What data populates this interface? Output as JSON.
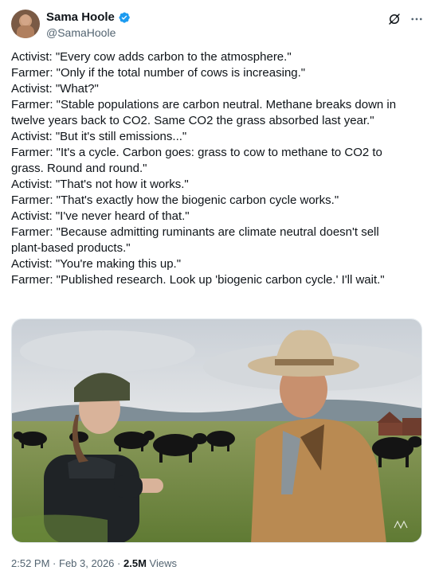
{
  "author": {
    "display_name": "Sama Hoole",
    "handle": "@SamaHoole",
    "verified": true,
    "avatar_icon": "user-avatar"
  },
  "header_actions": {
    "grok_icon": "grok-icon",
    "more_icon": "more-horizontal-icon"
  },
  "tweet": {
    "lines": [
      "Activist: \"Every cow adds carbon to the atmosphere.\"",
      "Farmer: \"Only if the total number of cows is increasing.\"",
      "Activist: \"What?\"",
      "Farmer: \"Stable populations are carbon neutral. Methane breaks down in",
      "twelve years back to CO2. Same CO2 the grass absorbed last year.\"",
      "Activist: \"But it's still emissions...\"",
      "Farmer: \"It's a cycle. Carbon goes: grass to cow to methane to CO2 to",
      "grass. Round and round.\"",
      "Activist: \"That's not how it works.\"",
      "Farmer: \"That's exactly how the biogenic carbon cycle works.\"",
      "Activist: \"I've never heard of that.\"",
      "Farmer: \"Because admitting ruminants are climate neutral doesn't sell",
      "plant-based products.\"",
      "Activist: \"You're making this up.\"",
      "Farmer: \"Published research. Look up 'biogenic carbon cycle.' I'll wait.\""
    ]
  },
  "media": {
    "type": "photo"
  },
  "meta": {
    "time": "2:52 PM",
    "separator": "·",
    "date": "Feb 3, 2026",
    "views_count": "2.5M",
    "views_label": "Views"
  },
  "colors": {
    "text_primary": "#0f1419",
    "text_secondary": "#536471",
    "verified_blue": "#1d9bf0"
  }
}
